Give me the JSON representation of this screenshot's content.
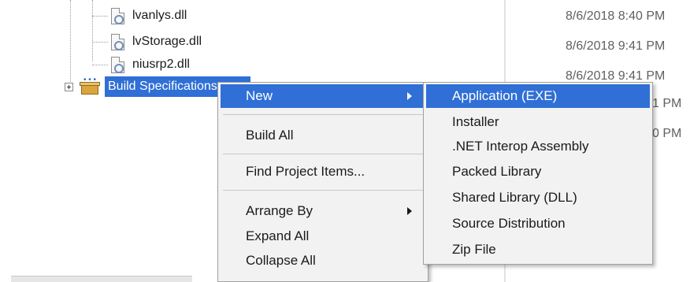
{
  "tree": {
    "files": [
      {
        "name": "lvanlys.dll",
        "date": "8/6/2018 8:40 PM"
      },
      {
        "name": "lvStorage.dll",
        "date": "8/6/2018 9:41 PM"
      },
      {
        "name": "niusrp2.dll",
        "date": "8/6/2018 9:41 PM"
      }
    ],
    "build_specifications": {
      "label": "Build Specifications",
      "date_partial_1": "1 PM",
      "date_partial_2": "0 PM"
    }
  },
  "context_menu": {
    "items": [
      {
        "label": "New",
        "has_submenu": true,
        "highlighted": true
      },
      {
        "label": "Build All"
      },
      {
        "label": "Find Project Items..."
      },
      {
        "label": "Arrange By",
        "has_submenu": true
      },
      {
        "label": "Expand All"
      },
      {
        "label": "Collapse All"
      }
    ]
  },
  "new_submenu": {
    "items": [
      {
        "label": "Application (EXE)",
        "highlighted": true
      },
      {
        "label": "Installer"
      },
      {
        "label": ".NET Interop Assembly"
      },
      {
        "label": "Packed Library"
      },
      {
        "label": "Shared Library (DLL)"
      },
      {
        "label": "Source Distribution"
      },
      {
        "label": "Zip File"
      }
    ]
  },
  "colors": {
    "selection": "#2f6fd6",
    "menu_background": "#f2f2f2",
    "date_text": "#606060"
  }
}
